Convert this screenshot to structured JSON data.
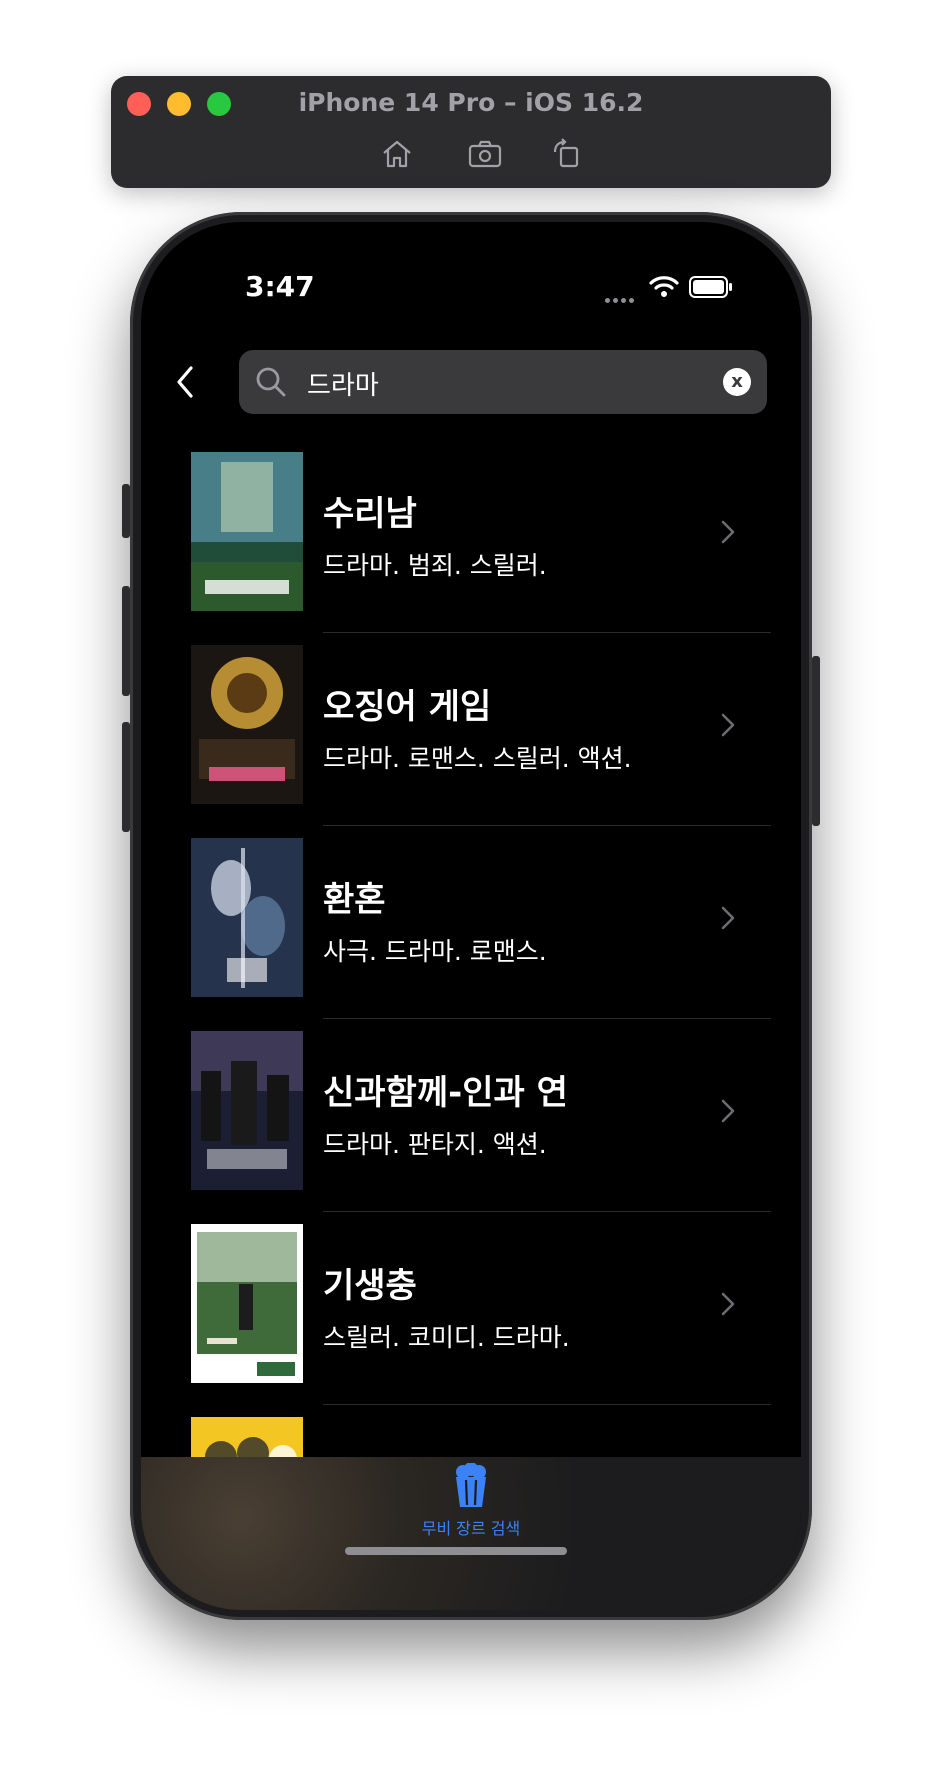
{
  "window": {
    "title": "iPhone 14 Pro – iOS 16.2",
    "toolbar_icons": [
      "home-icon",
      "screenshot-icon",
      "rotate-icon"
    ]
  },
  "status_bar": {
    "time": "3:47"
  },
  "search": {
    "value": "드라마",
    "clear_label": "x"
  },
  "movies": [
    {
      "title": "수리남",
      "genres": "드라마.  범죄.  스릴러.",
      "poster_palette": [
        "#1f4d3a",
        "#6aa7c6",
        "#2d5a2d"
      ]
    },
    {
      "title": "오징어 게임",
      "genres": "드라마.  로맨스.  스릴러.  액션.",
      "poster_palette": [
        "#5a3b14",
        "#d1a23a",
        "#1c1612"
      ]
    },
    {
      "title": "환혼",
      "genres": "사극.  드라마.  로맨스.",
      "poster_palette": [
        "#26334d",
        "#c7cfe0",
        "#4f6a8a"
      ]
    },
    {
      "title": "신과함께-인과 연",
      "genres": "드라마.  판타지.  액션.",
      "poster_palette": [
        "#1c1f33",
        "#4b4566",
        "#2a1f1f"
      ]
    },
    {
      "title": "기생충",
      "genres": "스릴러.  코미디.  드라마.",
      "poster_palette": [
        "#ffffff",
        "#3f6a3a",
        "#1c1c1c"
      ]
    },
    {
      "title": "",
      "genres": "",
      "poster_palette": [
        "#f3c623",
        "#2a2a2a",
        "#ffffff"
      ]
    }
  ],
  "tab_bar": {
    "items": [
      {
        "label": "무비 장르 검색",
        "icon": "popcorn-icon",
        "color": "#3b82f6"
      }
    ]
  }
}
